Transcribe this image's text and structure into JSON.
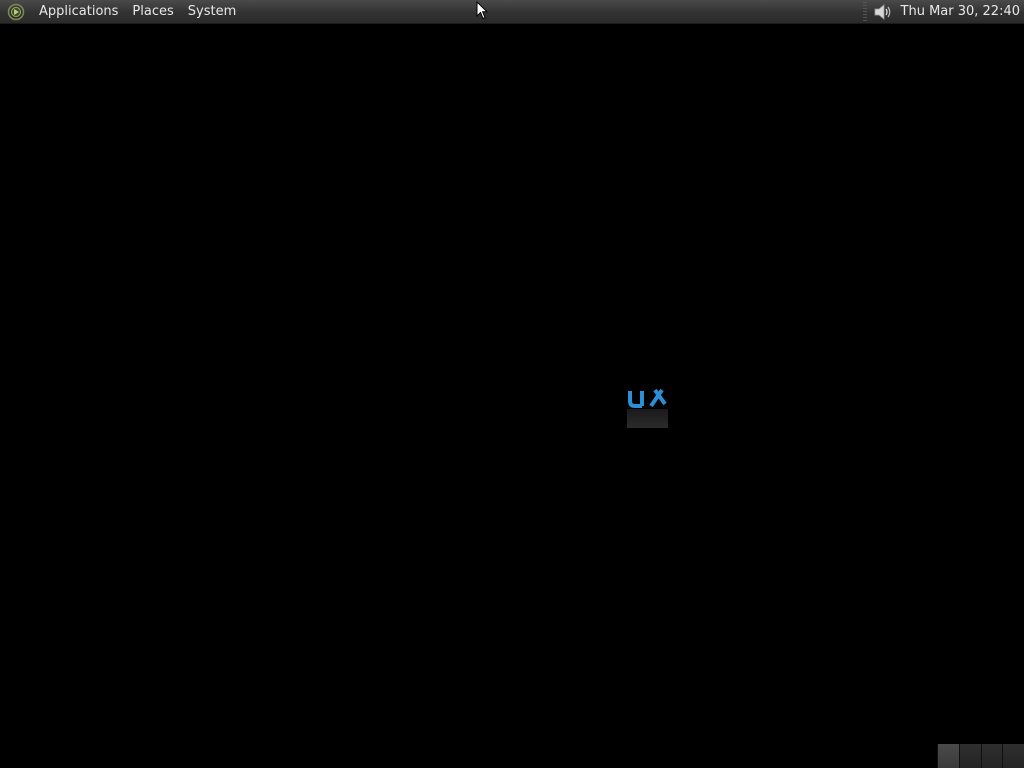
{
  "top_panel": {
    "menus": [
      {
        "label": "Applications"
      },
      {
        "label": "Places"
      },
      {
        "label": "System"
      }
    ],
    "logo_icon": "distro-logo-icon",
    "volume_icon": "speaker-volume-icon",
    "clock": "Thu Mar 30, 22:40"
  },
  "desktop": {
    "center_icon": "loading-app-icon",
    "accent_color": "#2a8fd4"
  },
  "workspace_switcher": {
    "workspace_count": 4,
    "active_workspace": 1
  },
  "colors": {
    "panel_background": "#323232",
    "panel_text": "#e8e8e8",
    "desktop_background": "#000000"
  }
}
